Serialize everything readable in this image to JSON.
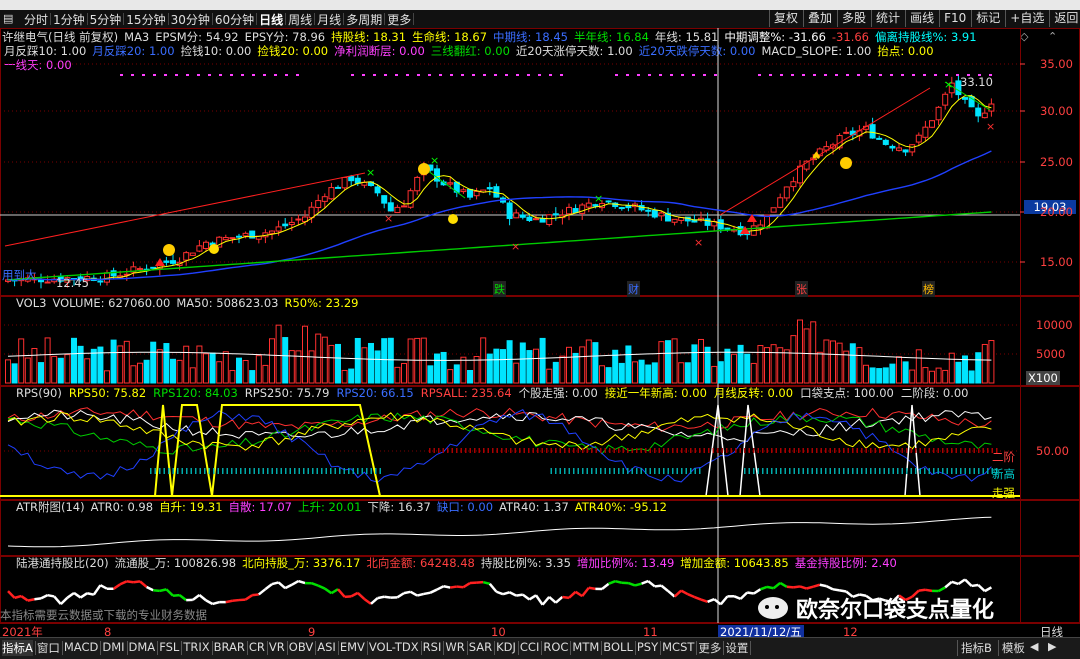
{
  "toolbar": {
    "periods": [
      "分时",
      "1分钟",
      "5分钟",
      "15分钟",
      "30分钟",
      "60分钟",
      "日线",
      "周线",
      "月线",
      "多周期",
      "更多"
    ],
    "right_buttons": [
      "复权",
      "叠加",
      "多股",
      "统计",
      "画线",
      "F10",
      "标记",
      "+自选",
      "返回"
    ]
  },
  "main": {
    "title": "许继电气(日线 前复权)",
    "row1": [
      {
        "t": "MA3",
        "c": "#dddddd"
      },
      {
        "t": "EPSM分: 54.92",
        "c": "#dddddd"
      },
      {
        "t": "EPSY分: 78.96",
        "c": "#dddddd"
      },
      {
        "t": "持股线: 18.31",
        "c": "#ffff00"
      },
      {
        "t": "生命线: 18.67",
        "c": "#ffff00"
      },
      {
        "t": "中期线: 18.45",
        "c": "#3a6dff"
      },
      {
        "t": "半年线: 16.84",
        "c": "#00dd00"
      },
      {
        "t": "年线: 15.81",
        "c": "#dddddd"
      },
      {
        "t": "中期调整%: -31.66",
        "c": "#ffffff"
      },
      {
        "t": "-31.66",
        "c": "#ff4040"
      },
      {
        "t": "偏离持股线%: 3.91",
        "c": "#00ffff"
      }
    ],
    "row2": [
      {
        "t": "月反踩10: 1.00",
        "c": "#dddddd"
      },
      {
        "t": "月反踩20: 1.00",
        "c": "#3a6dff"
      },
      {
        "t": "捡钱10: 0.00",
        "c": "#dddddd"
      },
      {
        "t": "捡钱20: 0.00",
        "c": "#ffff00"
      },
      {
        "t": "净利润断层: 0.00",
        "c": "#ff40ff"
      },
      {
        "t": "三线翻红: 0.00",
        "c": "#00dd00"
      },
      {
        "t": "近20天涨停天数: 1.00",
        "c": "#dddddd"
      },
      {
        "t": "近20天跌停天数: 0.00",
        "c": "#3a6dff"
      },
      {
        "t": "MACD_SLOPE: 1.00",
        "c": "#dddddd"
      },
      {
        "t": "抬点: 0.00",
        "c": "#ffff00"
      }
    ],
    "row3": [
      {
        "t": "一线天: 0.00",
        "c": "#ff40ff"
      }
    ],
    "price_axis": [
      "35.00",
      "30.00",
      "25.00",
      "20.00",
      "15.00"
    ],
    "current_price": "19.03",
    "high_label": "33.10",
    "low_label": "12.45",
    "low_prefix": "用到大",
    "event_labels": [
      {
        "t": "跌",
        "c": "#00dd00"
      },
      {
        "t": "财",
        "c": "#3a6dff"
      },
      {
        "t": "张",
        "c": "#ff4040"
      },
      {
        "t": "榜",
        "c": "#ffbb00"
      }
    ]
  },
  "vol": {
    "row": [
      {
        "t": "VOL3",
        "c": "#dddddd"
      },
      {
        "t": "VOLUME: 627060.00",
        "c": "#dddddd"
      },
      {
        "t": "MA50: 508623.03",
        "c": "#dddddd"
      },
      {
        "t": "R50%: 23.29",
        "c": "#ffff00"
      }
    ],
    "axis": [
      "10000",
      "5000"
    ],
    "unit": "X100"
  },
  "rps": {
    "row": [
      {
        "t": "RPS(90)",
        "c": "#dddddd"
      },
      {
        "t": "RPS50: 75.82",
        "c": "#ffff00"
      },
      {
        "t": "RPS120: 84.03",
        "c": "#00dd00"
      },
      {
        "t": "RPS250: 75.79",
        "c": "#dddddd"
      },
      {
        "t": "RPS20: 66.15",
        "c": "#3a6dff"
      },
      {
        "t": "RPSALL: 235.64",
        "c": "#ff4040"
      },
      {
        "t": "个股走强: 0.00",
        "c": "#dddddd"
      },
      {
        "t": "接近一年新高: 0.00",
        "c": "#ffff00"
      },
      {
        "t": "月线反转: 0.00",
        "c": "#ffff00"
      },
      {
        "t": "口袋支点: 100.00",
        "c": "#dddddd"
      },
      {
        "t": "二阶段: 0.00",
        "c": "#dddddd"
      }
    ],
    "axis": "50.00",
    "side_labels": [
      {
        "t": "二阶",
        "c": "#ff4040"
      },
      {
        "t": "新高",
        "c": "#00cccc"
      },
      {
        "t": "走强",
        "c": "#ffff00"
      }
    ]
  },
  "atr": {
    "row": [
      {
        "t": "ATR附图(14)",
        "c": "#dddddd"
      },
      {
        "t": "ATR0: 0.98",
        "c": "#dddddd"
      },
      {
        "t": "自升: 19.31",
        "c": "#ffff00"
      },
      {
        "t": "自散: 17.07",
        "c": "#ff40ff"
      },
      {
        "t": "上升: 20.01",
        "c": "#00dd00"
      },
      {
        "t": "下降: 16.37",
        "c": "#dddddd"
      },
      {
        "t": "缺口: 0.00",
        "c": "#3a6dff"
      },
      {
        "t": "ATR40: 1.37",
        "c": "#dddddd"
      },
      {
        "t": "ATR40%: -95.12",
        "c": "#ffff00"
      }
    ]
  },
  "hk": {
    "row": [
      {
        "t": "陆港通持股比(20)",
        "c": "#dddddd"
      },
      {
        "t": "流通股_万: 100826.98",
        "c": "#dddddd"
      },
      {
        "t": "北向持股_万: 3376.17",
        "c": "#ffff00"
      },
      {
        "t": "北向金额: 64248.48",
        "c": "#ff4040"
      },
      {
        "t": "持股比例%: 3.35",
        "c": "#dddddd"
      },
      {
        "t": "增加比例%: 13.49",
        "c": "#ff40ff"
      },
      {
        "t": "增加金额: 10643.85",
        "c": "#ffff00"
      },
      {
        "t": "基金持股比例: 2.40",
        "c": "#ff40ff"
      }
    ],
    "note": "本指标需要云数据或下载的专业财务数据",
    "watermark": "欧奈尔口袋支点量化"
  },
  "date_axis": {
    "year": "2021年",
    "months": [
      "8",
      "9",
      "10",
      "11",
      "12"
    ],
    "cursor_date": "2021/11/12/五",
    "period": "日线"
  },
  "bottom": {
    "tabs": [
      "指标A",
      "窗口",
      "MACD",
      "DMI",
      "DMA",
      "FSL",
      "TRIX",
      "BRAR",
      "CR",
      "VR",
      "OBV",
      "ASI",
      "EMV",
      "VOL-TDX",
      "RSI",
      "WR",
      "SAR",
      "KDJ",
      "CCI",
      "ROC",
      "MTM",
      "BOLL",
      "PSY",
      "MCST",
      "更多",
      "设置"
    ],
    "right": [
      "指标B",
      "模板"
    ]
  }
}
